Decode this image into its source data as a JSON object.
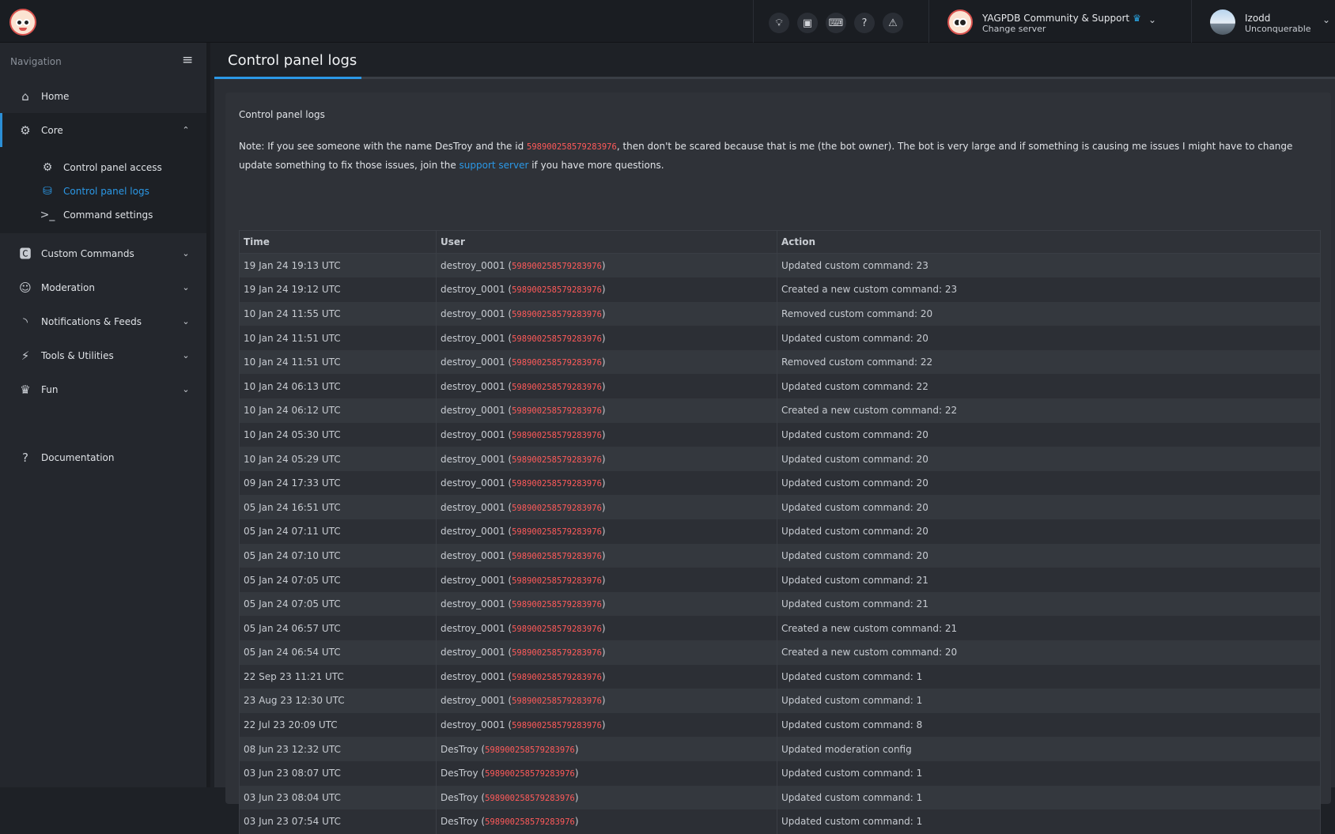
{
  "topbar": {
    "icons": [
      "lightbulb-icon",
      "chat-icon",
      "keyboard-icon",
      "help-icon",
      "warning-icon"
    ],
    "server": {
      "name": "YAGPDB Community & Support",
      "sub": "Change server"
    },
    "user": {
      "name": "Izodd",
      "sub": "Unconquerable"
    }
  },
  "sidebar": {
    "header": "Navigation",
    "items": [
      {
        "label": "Home"
      },
      {
        "label": "Core"
      },
      {
        "label": "Custom Commands"
      },
      {
        "label": "Moderation"
      },
      {
        "label": "Notifications & Feeds"
      },
      {
        "label": "Tools & Utilities"
      },
      {
        "label": "Fun"
      },
      {
        "label": "Documentation"
      }
    ],
    "core_sub": [
      {
        "label": "Control panel access"
      },
      {
        "label": "Control panel logs"
      },
      {
        "label": "Command settings"
      }
    ]
  },
  "page": {
    "title": "Control panel logs",
    "card_title": "Control panel logs",
    "note": {
      "part1": "Note: If you see someone with the name DesTroy and the id ",
      "id": "598900258579283976",
      "part2": ", then don't be scared because that is me (the bot owner). The bot is very large and if something is causing me issues I might have to change update something to fix those issues, join the ",
      "link": "support server",
      "part3": " if you have more questions."
    }
  },
  "table": {
    "headers": [
      "Time",
      "User",
      "Action"
    ],
    "rows": [
      {
        "time": "19 Jan 24 19:13 UTC",
        "user": "destroy_0001",
        "id": "598900258579283976",
        "action": "Updated custom command: 23"
      },
      {
        "time": "19 Jan 24 19:12 UTC",
        "user": "destroy_0001",
        "id": "598900258579283976",
        "action": "Created a new custom command: 23"
      },
      {
        "time": "10 Jan 24 11:55 UTC",
        "user": "destroy_0001",
        "id": "598900258579283976",
        "action": "Removed custom command: 20"
      },
      {
        "time": "10 Jan 24 11:51 UTC",
        "user": "destroy_0001",
        "id": "598900258579283976",
        "action": "Updated custom command: 20"
      },
      {
        "time": "10 Jan 24 11:51 UTC",
        "user": "destroy_0001",
        "id": "598900258579283976",
        "action": "Removed custom command: 22"
      },
      {
        "time": "10 Jan 24 06:13 UTC",
        "user": "destroy_0001",
        "id": "598900258579283976",
        "action": "Updated custom command: 22"
      },
      {
        "time": "10 Jan 24 06:12 UTC",
        "user": "destroy_0001",
        "id": "598900258579283976",
        "action": "Created a new custom command: 22"
      },
      {
        "time": "10 Jan 24 05:30 UTC",
        "user": "destroy_0001",
        "id": "598900258579283976",
        "action": "Updated custom command: 20"
      },
      {
        "time": "10 Jan 24 05:29 UTC",
        "user": "destroy_0001",
        "id": "598900258579283976",
        "action": "Updated custom command: 20"
      },
      {
        "time": "09 Jan 24 17:33 UTC",
        "user": "destroy_0001",
        "id": "598900258579283976",
        "action": "Updated custom command: 20"
      },
      {
        "time": "05 Jan 24 16:51 UTC",
        "user": "destroy_0001",
        "id": "598900258579283976",
        "action": "Updated custom command: 20"
      },
      {
        "time": "05 Jan 24 07:11 UTC",
        "user": "destroy_0001",
        "id": "598900258579283976",
        "action": "Updated custom command: 20"
      },
      {
        "time": "05 Jan 24 07:10 UTC",
        "user": "destroy_0001",
        "id": "598900258579283976",
        "action": "Updated custom command: 20"
      },
      {
        "time": "05 Jan 24 07:05 UTC",
        "user": "destroy_0001",
        "id": "598900258579283976",
        "action": "Updated custom command: 21"
      },
      {
        "time": "05 Jan 24 07:05 UTC",
        "user": "destroy_0001",
        "id": "598900258579283976",
        "action": "Updated custom command: 21"
      },
      {
        "time": "05 Jan 24 06:57 UTC",
        "user": "destroy_0001",
        "id": "598900258579283976",
        "action": "Created a new custom command: 21"
      },
      {
        "time": "05 Jan 24 06:54 UTC",
        "user": "destroy_0001",
        "id": "598900258579283976",
        "action": "Created a new custom command: 20"
      },
      {
        "time": "22 Sep 23 11:21 UTC",
        "user": "destroy_0001",
        "id": "598900258579283976",
        "action": "Updated custom command: 1"
      },
      {
        "time": "23 Aug 23 12:30 UTC",
        "user": "destroy_0001",
        "id": "598900258579283976",
        "action": "Updated custom command: 1"
      },
      {
        "time": "22 Jul 23 20:09 UTC",
        "user": "destroy_0001",
        "id": "598900258579283976",
        "action": "Updated custom command: 8"
      },
      {
        "time": "08 Jun 23 12:32 UTC",
        "user": "DesTroy",
        "id": "598900258579283976",
        "action": "Updated moderation config"
      },
      {
        "time": "03 Jun 23 08:07 UTC",
        "user": "DesTroy",
        "id": "598900258579283976",
        "action": "Updated custom command: 1"
      },
      {
        "time": "03 Jun 23 08:04 UTC",
        "user": "DesTroy",
        "id": "598900258579283976",
        "action": "Updated custom command: 1"
      },
      {
        "time": "03 Jun 23 07:54 UTC",
        "user": "DesTroy",
        "id": "598900258579283976",
        "action": "Updated custom command: 1"
      }
    ]
  },
  "colors": {
    "accent": "#2b98e6",
    "id_red": "#ff5a5a",
    "crown": "#29a3e0"
  }
}
